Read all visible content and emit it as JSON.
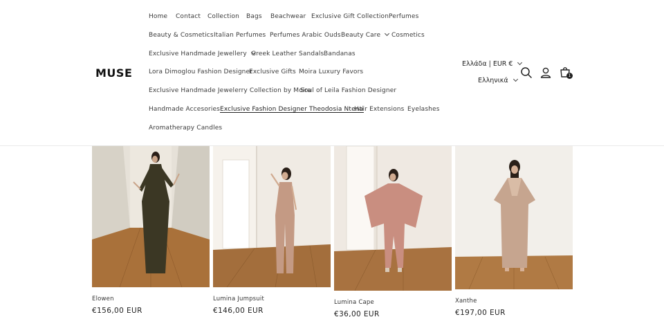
{
  "brand": {
    "logo_text": "MUSE"
  },
  "nav": {
    "home": "Home",
    "contact": "Contact",
    "collection": "Collection",
    "bags": "Bags",
    "beachwear": "Beachwear",
    "exclusive_gift_collection": "Exclusive Gift Collection",
    "perfumes": "Perfumes",
    "beauty_cosmetics": "Beauty & Cosmetics",
    "italian_perfumes": "Italian Perfumes",
    "perfumes_arabic_ouds": "Perfumes Arabic Ouds",
    "beauty_care": "Beauty Care",
    "cosmetics": "Cosmetics",
    "exclusive_handmade_jewellery": "Exclusive Handmade Jewellery",
    "greek_leather_sandals": "Greek Leather Sandals",
    "bandanas": "Bandanas",
    "lora_dimoglou": "Lora Dimoglou Fashion Designer",
    "exclusive_gifts": "Exclusive Gifts",
    "moira_luxury_favors": "Moira Luxury Favors",
    "exclusive_jewelerry_moira": "Exclusive Handmade Jewelerry Collection by Moira",
    "soul_of_leila": "Soul of Leila Fashion Designer",
    "handmade_accesories": "Handmade Accesories",
    "theodosia_ntenti": "Exclusive Fashion Designer Theodosia Ntenti",
    "hair_extensions": "Hair Extensions",
    "eyelashes": "Eyelashes",
    "aromatherapy_candles": "Aromatherapy Candles"
  },
  "locale": {
    "country_currency": "Ελλάδα | EUR €",
    "language": "Ελληνικά"
  },
  "header_icons": {
    "search": "search-icon",
    "account": "account-icon",
    "cart": "cart-icon",
    "cart_count": "1"
  },
  "products": [
    {
      "name": "Elowen",
      "price": "€156,00 EUR",
      "dress_color": "#3b3724"
    },
    {
      "name": "Lumina Jumpsuit",
      "price": "€146,00 EUR",
      "dress_color": "#c49a84"
    },
    {
      "name": "Lumina Cape",
      "price": "€36,00 EUR",
      "dress_color": "#c98e80"
    },
    {
      "name": "Xanthe",
      "price": "€197,00 EUR",
      "dress_color": "#c6a58f"
    }
  ]
}
